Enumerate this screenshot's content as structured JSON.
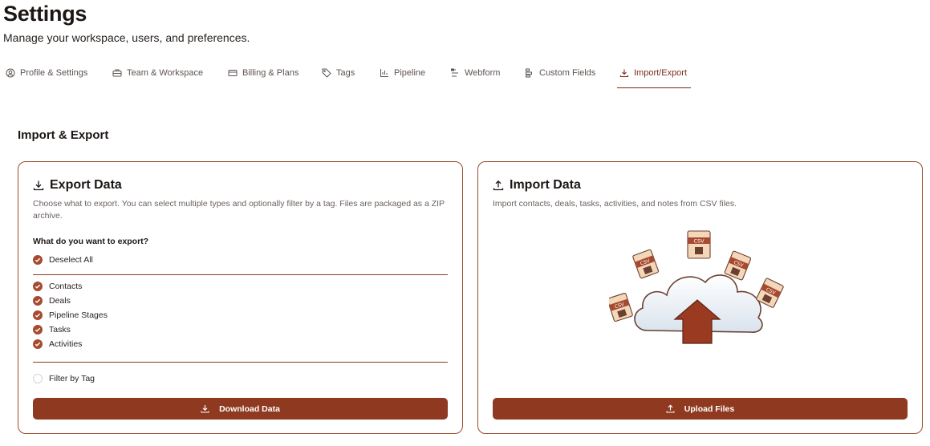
{
  "header": {
    "title": "Settings",
    "subtitle": "Manage your workspace, users, and preferences."
  },
  "tabs": [
    {
      "label": "Profile & Settings",
      "icon": "user-circle-icon"
    },
    {
      "label": "Team & Workspace",
      "icon": "briefcase-icon"
    },
    {
      "label": "Billing & Plans",
      "icon": "credit-card-icon"
    },
    {
      "label": "Tags",
      "icon": "tag-icon"
    },
    {
      "label": "Pipeline",
      "icon": "chart-icon"
    },
    {
      "label": "Webform",
      "icon": "form-icon"
    },
    {
      "label": "Custom Fields",
      "icon": "fields-icon"
    },
    {
      "label": "Import/Export",
      "icon": "download-icon",
      "active": true
    }
  ],
  "section": {
    "title": "Import & Export"
  },
  "export": {
    "title": "Export Data",
    "description": "Choose what to export. You can select multiple types and optionally filter by a tag. Files are packaged as a ZIP archive.",
    "question": "What do you want to export?",
    "deselect_all": "Deselect All",
    "items": [
      "Contacts",
      "Deals",
      "Pipeline Stages",
      "Tasks",
      "Activities"
    ],
    "filter_by_tag": "Filter by Tag",
    "button": "Download Data"
  },
  "import": {
    "title": "Import Data",
    "description": "Import contacts, deals, tasks, activities, and notes from CSV files.",
    "csv_label": "CSV",
    "button": "Upload Files"
  },
  "colors": {
    "accent": "#8f3a20",
    "border": "#9a4a2a",
    "check": "#a84a30"
  }
}
